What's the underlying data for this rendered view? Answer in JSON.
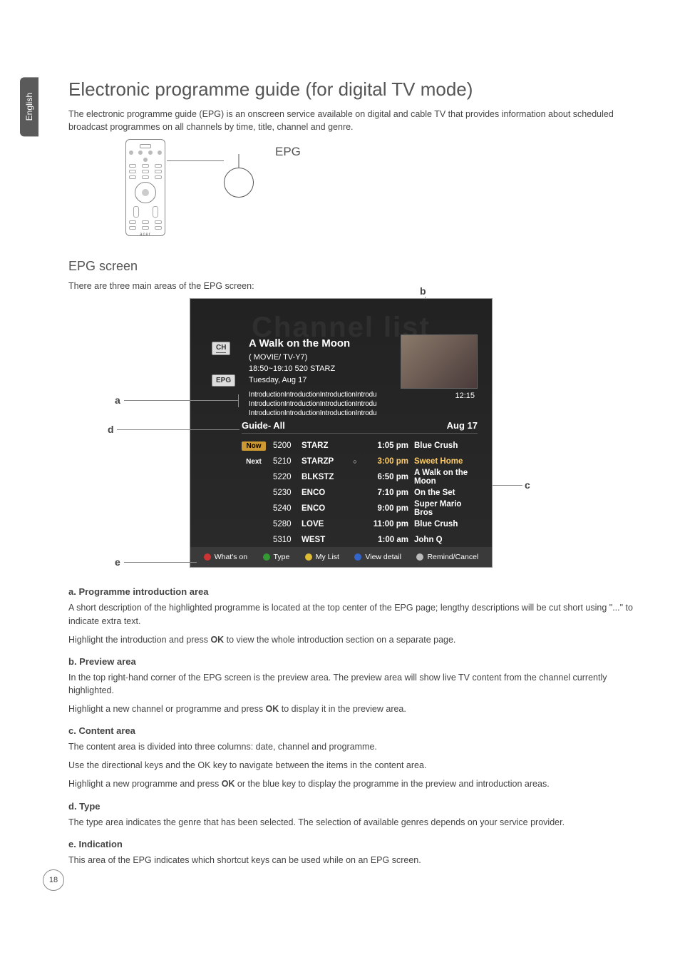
{
  "sideTab": "English",
  "pageNum": "18",
  "title": "Electronic programme guide (for digital TV mode)",
  "intro": "The electronic programme guide (EPG) is an onscreen service available on digital and cable TV that provides information about scheduled broadcast programmes on all channels by time, title, channel and genre.",
  "remoteBrand": "acer",
  "epgLabel": "EPG",
  "epgScreenHeading": "EPG screen",
  "epgScreenText": "There are three main areas of the EPG screen:",
  "callouts": {
    "a": "a",
    "b": "b",
    "c": "c",
    "d": "d",
    "e": "e"
  },
  "epgShot": {
    "watermark": "Channel list",
    "chipCH": "CH",
    "chipEPG": "EPG",
    "title": "A Walk on the Moon",
    "meta1": "( MOVIE/ TV-Y7)",
    "meta2": "18:50~19:10  520 STARZ",
    "meta3": "Tuesday, Aug 17",
    "introLines": "IntroductionIntroductionIntroductionIntrodu\nIntroductionIntroductionIntroductionIntrodu\nIntroductionIntroductionIntroductionIntrodu",
    "clock": "12:15",
    "guideTitle": "Guide- All",
    "guideDate": "Aug 17",
    "now": "Now",
    "next": "Next",
    "rows": [
      {
        "chn": "5200",
        "name": "STARZ",
        "mark": "",
        "time": "1:05 pm",
        "prog": "Blue Crush",
        "hl": false
      },
      {
        "chn": "5210",
        "name": "STARZP",
        "mark": "○",
        "time": "3:00 pm",
        "prog": "Sweet Home",
        "hl": true
      },
      {
        "chn": "5220",
        "name": "BLKSTZ",
        "mark": "",
        "time": "6:50 pm",
        "prog": "A Walk on the Moon",
        "hl": false
      },
      {
        "chn": "5230",
        "name": "ENCO",
        "mark": "",
        "time": "7:10 pm",
        "prog": "On the Set",
        "hl": false
      },
      {
        "chn": "5240",
        "name": "ENCO",
        "mark": "",
        "time": "9:00 pm",
        "prog": "Super Mario Bros",
        "hl": false
      },
      {
        "chn": "5280",
        "name": "LOVE",
        "mark": "",
        "time": "11:00 pm",
        "prog": "Blue Crush",
        "hl": false
      },
      {
        "chn": "5310",
        "name": "WEST",
        "mark": "",
        "time": "1:00 am",
        "prog": "John Q",
        "hl": false
      }
    ],
    "footer": {
      "whatson": "What's on",
      "type": "Type",
      "mylist": "My List",
      "viewdetail": "View detail",
      "remind": "Remind/Cancel"
    }
  },
  "sections": {
    "a": {
      "h": "a.  Programme introduction area",
      "p1": "A short description of the highlighted programme is located at the top center of the EPG page; lengthy descriptions will be cut short using \"...\" to indicate extra text.",
      "p2a": "Highlight the introduction and press ",
      "p2b": "OK",
      "p2c": " to view the whole introduction section on a separate page."
    },
    "b": {
      "h": "b.  Preview area",
      "p1": "In the top right-hand corner of the EPG screen is the preview area. The preview area will show live TV content from the channel currently highlighted.",
      "p2a": "Highlight a new channel or programme and press ",
      "p2b": "OK",
      "p2c": " to display it in the preview area."
    },
    "c": {
      "h": "c.  Content area",
      "p1": "The content area is divided into three columns: date, channel and programme.",
      "p2": "Use the directional keys and the OK key to navigate between the items in the content area.",
      "p3a": "Highlight a new programme and press ",
      "p3b": "OK",
      "p3c": " or the blue key to display the programme in the preview and introduction areas."
    },
    "d": {
      "h": "d.  Type",
      "p1": "The type area indicates the genre that has been selected. The selection of  available genres depends on your service provider."
    },
    "e": {
      "h": "e.  Indication",
      "p1": "This area of the EPG indicates which shortcut keys can be used while on an EPG screen."
    }
  }
}
